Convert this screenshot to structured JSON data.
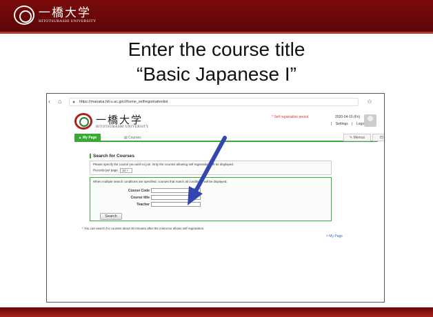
{
  "slide": {
    "logo_jp": "一橋大学",
    "logo_en": "HITOTSUBASHI UNIVERSITY",
    "title_line1": "Enter the course title",
    "title_line2": "“Basic Japanese I”"
  },
  "browser": {
    "url": "https://manaba.hit-u.ac.jp/ct/home_selfregistrationlist",
    "back_icon": "‹",
    "home_icon": "⌂",
    "lock_icon": "🔒",
    "bookmark_icon": "☆"
  },
  "site": {
    "logo_jp": "一橋大学",
    "logo_en": "HITOTSUBASHI UNIVERSITY",
    "period_text": "* Self registration period",
    "date_text": "2020-04-10 (Fri)",
    "settings_label": "Settings",
    "separator": "|",
    "logout_label": "Logout",
    "tabs": {
      "my_page": "My Page",
      "courses": "Courses",
      "memos": "Memos",
      "language": "日本語"
    }
  },
  "search": {
    "title": "Search for Courses",
    "description": "Please specify the course you wish to join. Only the courses allowing self registration will be displayed.",
    "records_per_page_label": "Records per page",
    "records_per_page_value": "10",
    "conditions_note": "When multiple search conditions are specified, courses that match all conditions will be displayed.",
    "fields": [
      {
        "label": "Course Code",
        "value": ""
      },
      {
        "label": "Course title",
        "value": ""
      },
      {
        "label": "Teacher",
        "value": ""
      }
    ],
    "search_button": "Search",
    "footer_note": "* You can search for courses about 30 minutes after the instructor allows self registration.",
    "my_page_link": "> My Page"
  },
  "colors": {
    "slide_header": "#6a0707",
    "accent_green": "#3aaa35",
    "arrow_blue": "#3346b0",
    "period_red": "#dd3333"
  }
}
